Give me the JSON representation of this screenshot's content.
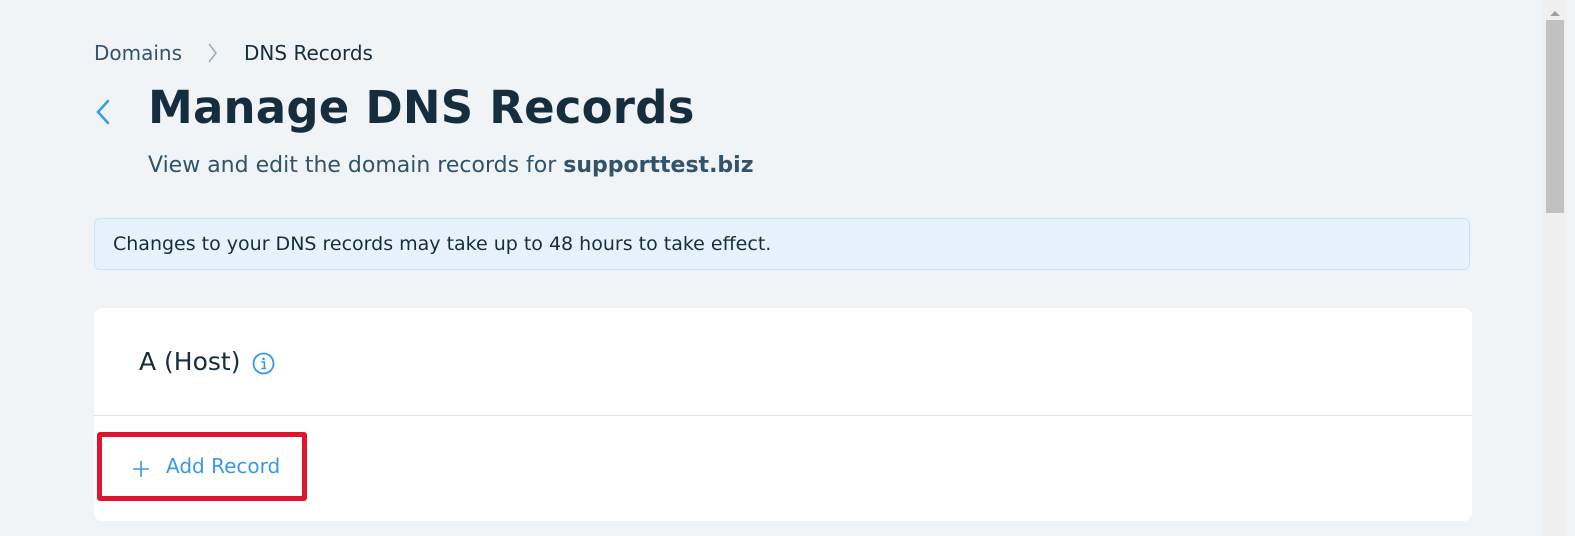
{
  "breadcrumb": {
    "parent": "Domains",
    "current": "DNS Records"
  },
  "header": {
    "title": "Manage DNS Records",
    "subtitle_prefix": "View and edit the domain records for ",
    "domain": "supporttest.biz"
  },
  "notice": {
    "text": "Changes to your DNS records may take up to 48 hours to take effect."
  },
  "section": {
    "title": "A (Host)",
    "add_label": "Add Record"
  },
  "icons": {
    "back": "chevron-left-icon",
    "breadcrumb_separator": "chevron-right-icon",
    "info": "info-icon",
    "add": "plus-icon"
  },
  "colors": {
    "accent": "#3899ec",
    "highlight": "#e0142f",
    "notice_bg": "#e7f3fc",
    "page_bg": "#f0f4f7"
  }
}
